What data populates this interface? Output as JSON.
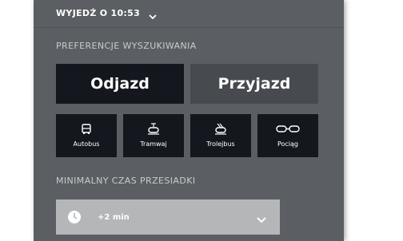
{
  "departure": {
    "label": "WYJEDŹ O 10:53",
    "chevron_icon": "chevron-down-icon"
  },
  "preferences": {
    "section_title": "PREFERENCJE WYSZUKIWANIA",
    "segment": {
      "options": [
        "Odjazd",
        "Przyjazd"
      ],
      "selected": "Odjazd"
    },
    "modes": [
      {
        "label": "Autobus",
        "icon": "bus-icon"
      },
      {
        "label": "Tramwaj",
        "icon": "tram-icon"
      },
      {
        "label": "Trolejbus",
        "icon": "trolleybus-icon"
      },
      {
        "label": "Pociąg",
        "icon": "train-icon"
      }
    ]
  },
  "transfer": {
    "section_title": "MINIMALNY CZAS PRZESIADKI",
    "value": "+2 min",
    "icon": "clock-icon"
  },
  "colors": {
    "panel_bg": "#5b5e62",
    "active_bg": "#14181e",
    "inactive_bg": "#474a4f",
    "dropdown_bg": "#b4b6b8"
  }
}
